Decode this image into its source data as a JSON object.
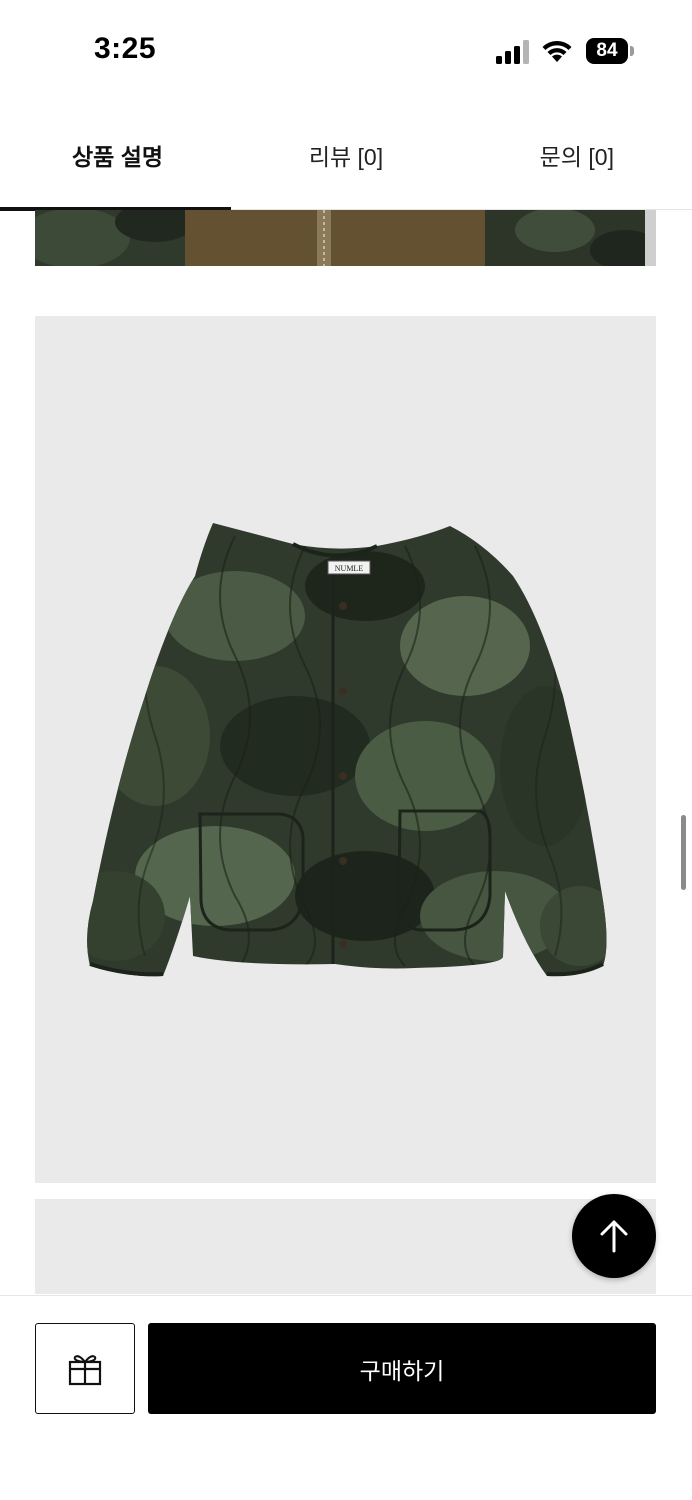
{
  "status_bar": {
    "time": "3:25",
    "battery": "84"
  },
  "tabs": [
    {
      "label": "상품 설명",
      "active": true
    },
    {
      "label": "리뷰 [0]",
      "active": false
    },
    {
      "label": "문의 [0]",
      "active": false
    }
  ],
  "product": {
    "label_tag": "NUMLE"
  },
  "bottom_bar": {
    "buy_label": "구매하기"
  },
  "icons": {
    "scroll_top": "arrow-up-icon",
    "gift": "gift-icon",
    "signal": "signal-icon",
    "wifi": "wifi-icon",
    "battery": "battery-icon"
  },
  "colors": {
    "accent": "#000000",
    "image_bg": "#eaeaea",
    "camo_dark": "#2f3a2c",
    "camo_mid": "#4a5a44"
  }
}
